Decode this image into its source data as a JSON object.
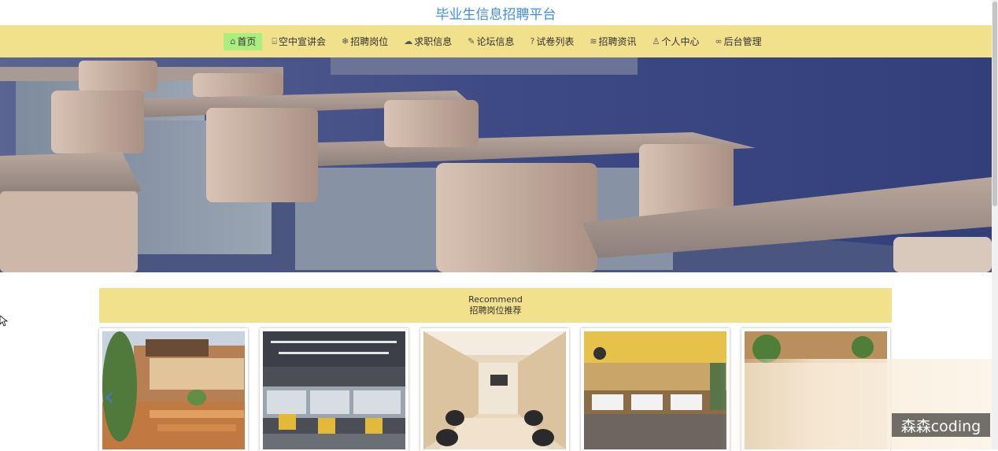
{
  "site": {
    "title": "毕业生信息招聘平台"
  },
  "nav": {
    "items": [
      {
        "label": "首页",
        "icon": "home-icon",
        "glyph": "⌂",
        "active": true
      },
      {
        "label": "空中宣讲会",
        "icon": "broadcast-icon",
        "glyph": "⌸"
      },
      {
        "label": "招聘岗位",
        "icon": "snowflake-icon",
        "glyph": "❄"
      },
      {
        "label": "求职信息",
        "icon": "cloud-icon",
        "glyph": "☁"
      },
      {
        "label": "论坛信息",
        "icon": "edit-icon",
        "glyph": "✎"
      },
      {
        "label": "试卷列表",
        "icon": "help-icon",
        "glyph": "?"
      },
      {
        "label": "招聘资讯",
        "icon": "graduation-cap-icon",
        "glyph": "≋"
      },
      {
        "label": "个人中心",
        "icon": "user-icon",
        "glyph": "♙"
      },
      {
        "label": "后台管理",
        "icon": "link-icon",
        "glyph": "∞"
      }
    ]
  },
  "banner": {
    "image": "classroom-desks-illustration",
    "slides": 3,
    "active_slide": 1
  },
  "recommend": {
    "title_en": "Recommend",
    "title_cn": "招聘岗位推荐",
    "cards": [
      {
        "image": "mcdonalds-outdoor-terrace"
      },
      {
        "image": "open-office-cubicles"
      },
      {
        "image": "conference-room"
      },
      {
        "image": "creative-office-yellow-ceiling"
      },
      {
        "image": "office-with-plants"
      }
    ]
  },
  "watermark": {
    "text": "森森coding"
  },
  "colors": {
    "nav_bg": "#f1e08c",
    "active_nav": "#a9ee7e",
    "title": "#3d8fe0"
  }
}
